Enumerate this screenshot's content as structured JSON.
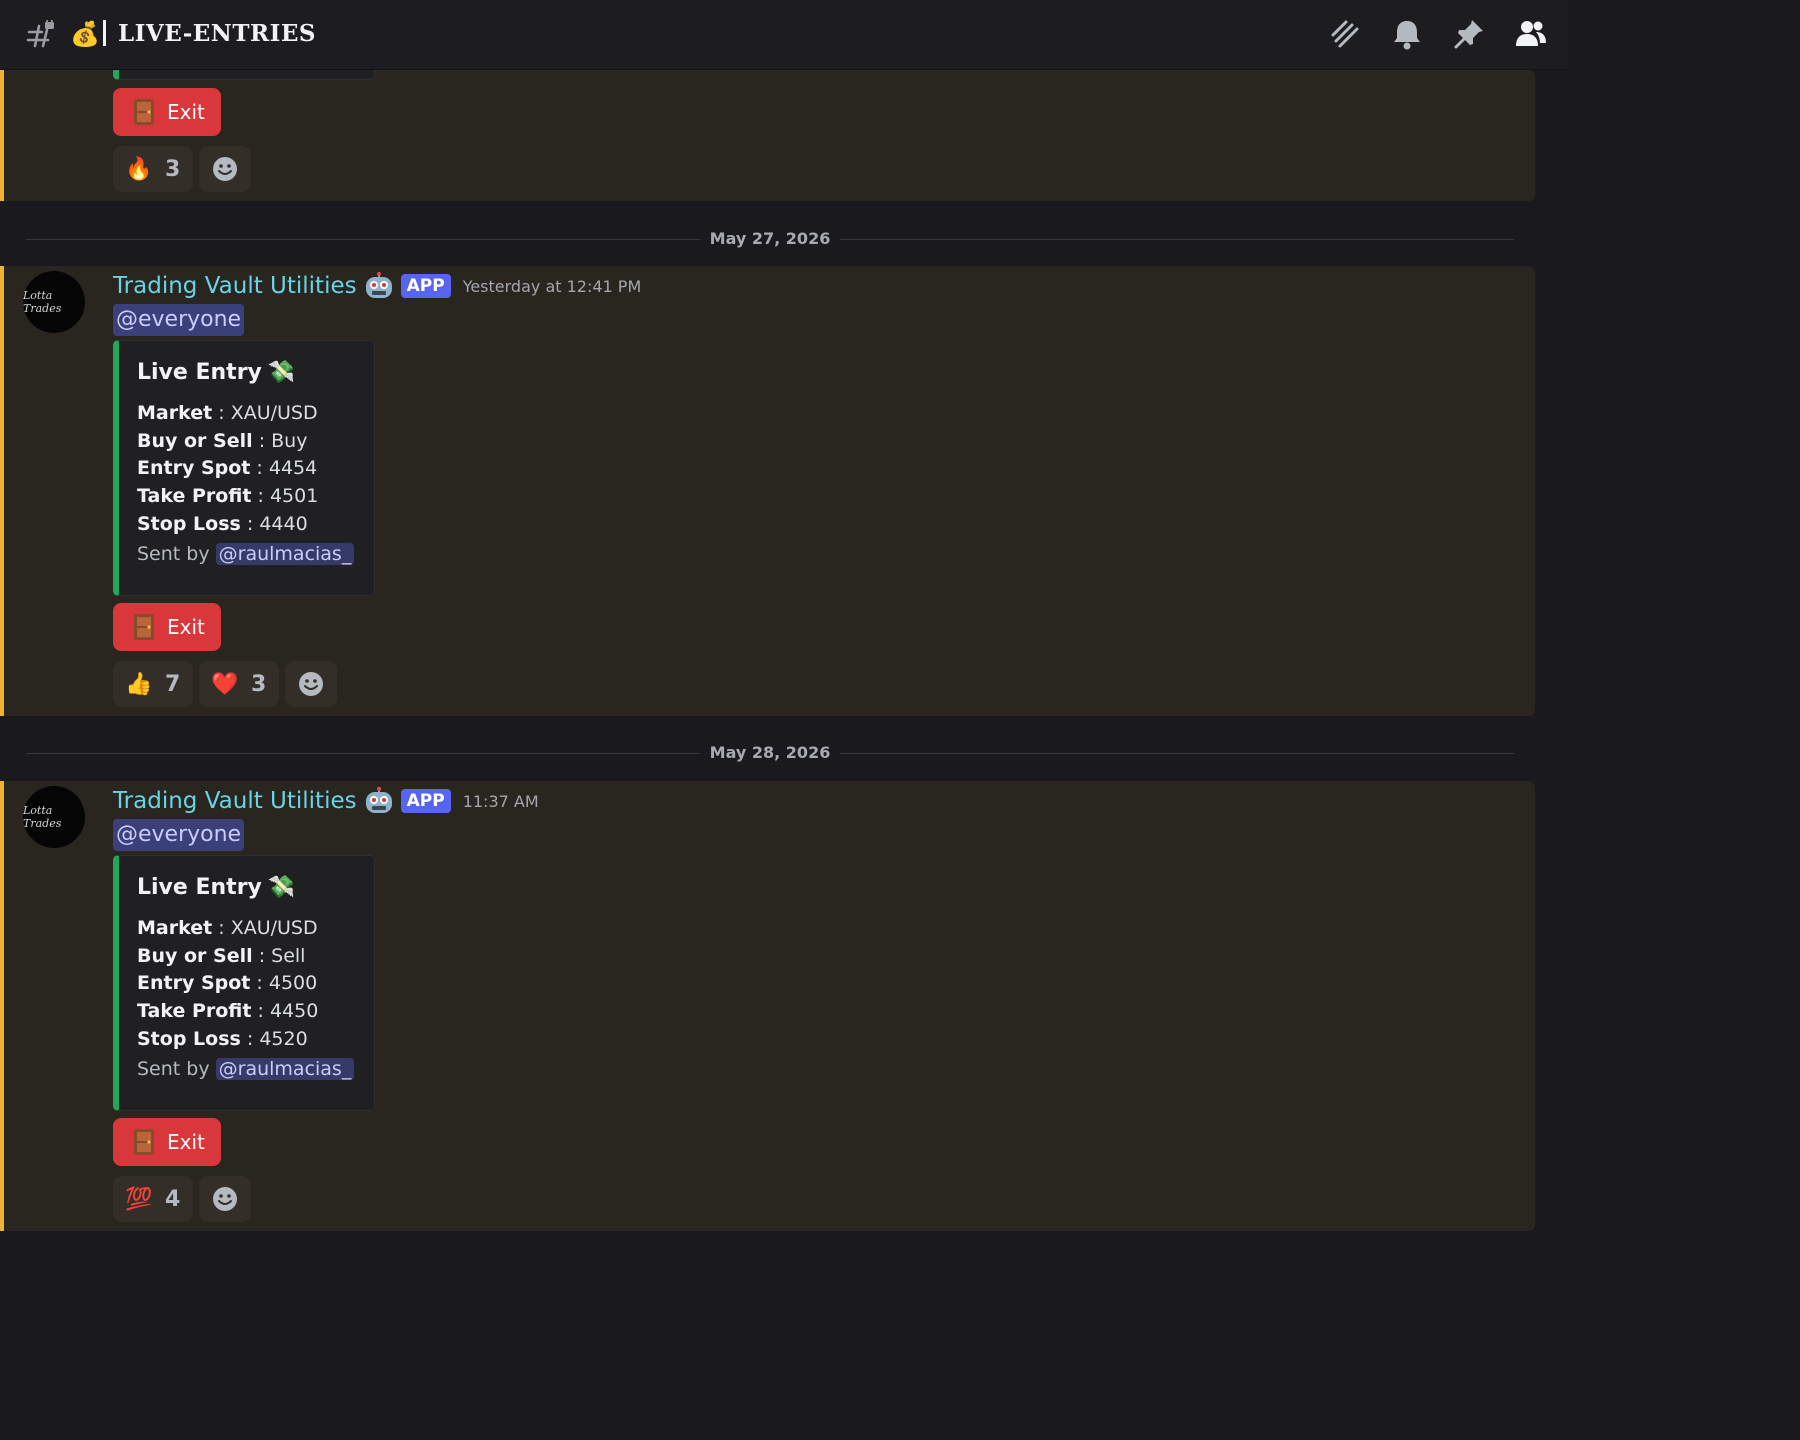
{
  "header": {
    "channel_emoji": "💰",
    "channel_name": "LIVE-ENTRIES",
    "icons": [
      "threads-icon",
      "bell-icon",
      "pin-icon",
      "members-icon"
    ]
  },
  "top_message": {
    "exit_label": "Exit",
    "reactions": [
      {
        "emoji": "🔥",
        "count": "3"
      }
    ]
  },
  "dividers": [
    "May 27, 2026",
    "May 28, 2026"
  ],
  "messages": [
    {
      "author": "Trading Vault Utilities",
      "badge": "APP",
      "timestamp": "Yesterday at 12:41 PM",
      "mention": "@everyone",
      "embed": {
        "title": "Live Entry",
        "title_emoji": "💸",
        "fields": [
          {
            "label": "Market",
            "value": "XAU/USD"
          },
          {
            "label": "Buy or Sell",
            "value": "Buy"
          },
          {
            "label": "Entry Spot",
            "value": "4454"
          },
          {
            "label": "Take Profit",
            "value": "4501"
          },
          {
            "label": "Stop Loss",
            "value": "4440"
          }
        ],
        "sent_by_label": "Sent by",
        "sent_by_user": "@raulmacias_"
      },
      "exit_label": "Exit",
      "reactions": [
        {
          "emoji": "👍",
          "count": "7"
        },
        {
          "emoji": "❤️",
          "count": "3"
        }
      ]
    },
    {
      "author": "Trading Vault Utilities",
      "badge": "APP",
      "timestamp": "11:37 AM",
      "mention": "@everyone",
      "embed": {
        "title": "Live Entry",
        "title_emoji": "💸",
        "fields": [
          {
            "label": "Market",
            "value": "XAU/USD"
          },
          {
            "label": "Buy or Sell",
            "value": "Sell"
          },
          {
            "label": "Entry Spot",
            "value": "4500"
          },
          {
            "label": "Take Profit",
            "value": "4450"
          },
          {
            "label": "Stop Loss",
            "value": "4520"
          }
        ],
        "sent_by_label": "Sent by",
        "sent_by_user": "@raulmacias_"
      },
      "exit_label": "Exit",
      "reactions": [
        {
          "emoji": "💯",
          "count": "4"
        }
      ]
    }
  ],
  "colors": {
    "highlight_bar": "#f0b232",
    "embed_bar": "#23a55a",
    "exit_button": "#da373c",
    "app_badge": "#5865f2",
    "author": "#6ad3e6"
  }
}
